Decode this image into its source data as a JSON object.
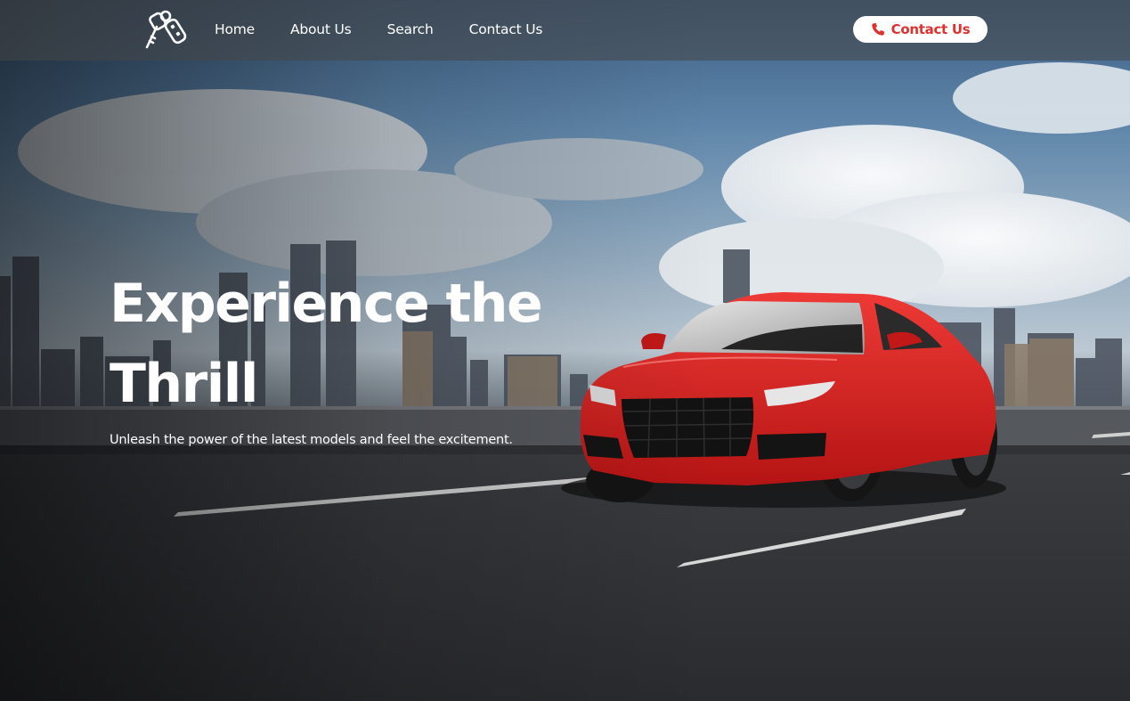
{
  "nav": {
    "logo_icon": "car-keys-icon",
    "links": [
      "Home",
      "About Us",
      "Search",
      "Contact Us"
    ],
    "cta": {
      "label": "Contact Us",
      "icon": "phone-icon"
    }
  },
  "hero": {
    "headline": "Experience the Thrill",
    "tagline": "Unleash the power of the latest models and feel the excitement."
  },
  "colors": {
    "accent": "#e0312f",
    "nav_text": "#ffffff",
    "button_bg": "#ffffff",
    "car": "#d81c1c"
  }
}
